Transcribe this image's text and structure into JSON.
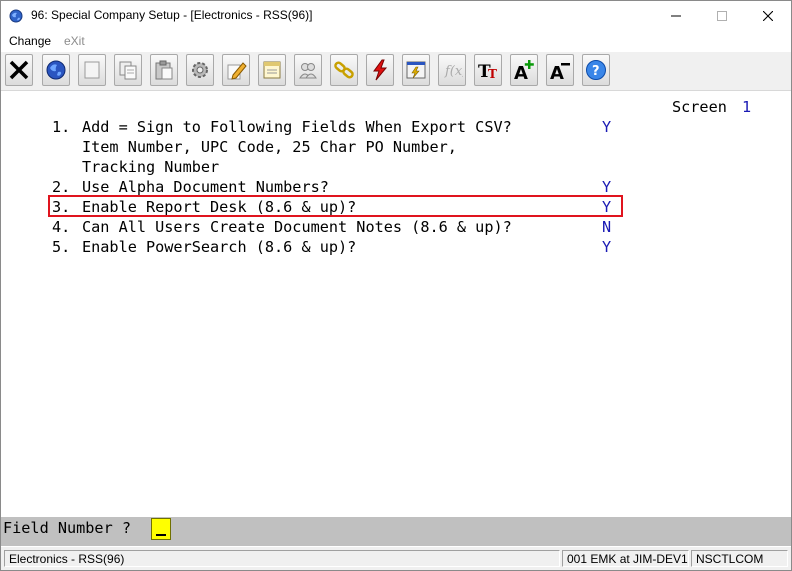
{
  "window": {
    "title": "96: Special Company Setup - [Electronics - RSS(96)]",
    "controls": {
      "minimize": "—",
      "maximize": "☐",
      "close": "✕"
    }
  },
  "menu": {
    "items": [
      {
        "label": "Change",
        "enabled": true
      },
      {
        "label": "eXit",
        "enabled": false
      }
    ]
  },
  "toolbar": {
    "buttons": [
      {
        "name": "exit-icon"
      },
      {
        "name": "globe-icon"
      },
      {
        "name": "blank-page-icon"
      },
      {
        "name": "copy-icon"
      },
      {
        "name": "paste-icon"
      },
      {
        "name": "settings-gear-icon"
      },
      {
        "name": "edit-pencil-icon"
      },
      {
        "name": "notes-icon"
      },
      {
        "name": "users-icon"
      },
      {
        "name": "chain-link-icon"
      },
      {
        "name": "lightning-icon"
      },
      {
        "name": "report-chart-icon"
      },
      {
        "name": "function-icon"
      },
      {
        "name": "font-size-icon"
      },
      {
        "name": "font-increase-icon"
      },
      {
        "name": "font-decrease-icon"
      },
      {
        "name": "help-icon"
      }
    ]
  },
  "screen": {
    "label": "Screen",
    "number": "1",
    "options": [
      {
        "number": "1.",
        "text": "Add = Sign to Following Fields When Export CSV?",
        "value": "Y"
      },
      {
        "number": "",
        "text": "Item Number, UPC Code, 25 Char PO Number,",
        "value": ""
      },
      {
        "number": "",
        "text": "Tracking Number",
        "value": ""
      },
      {
        "number": "2.",
        "text": "Use Alpha Document Numbers?",
        "value": "Y"
      },
      {
        "number": "3.",
        "text": "Enable Report Desk (8.6 & up)?",
        "value": "Y"
      },
      {
        "number": "4.",
        "text": "Can All Users Create Document Notes (8.6 & up)?",
        "value": "N"
      },
      {
        "number": "5.",
        "text": "Enable PowerSearch (8.6 & up)?",
        "value": "Y"
      }
    ]
  },
  "prompt": {
    "label": "Field Number ?",
    "value": "_"
  },
  "status": {
    "company": "Electronics - RSS(96)",
    "session": "001 EMK at JIM-DEV1",
    "program": "NSCTLCOM"
  },
  "colors": {
    "value_blue": "#1a1ab4",
    "highlight_red": "#e0141e",
    "cursor_yellow": "#ffff00"
  }
}
